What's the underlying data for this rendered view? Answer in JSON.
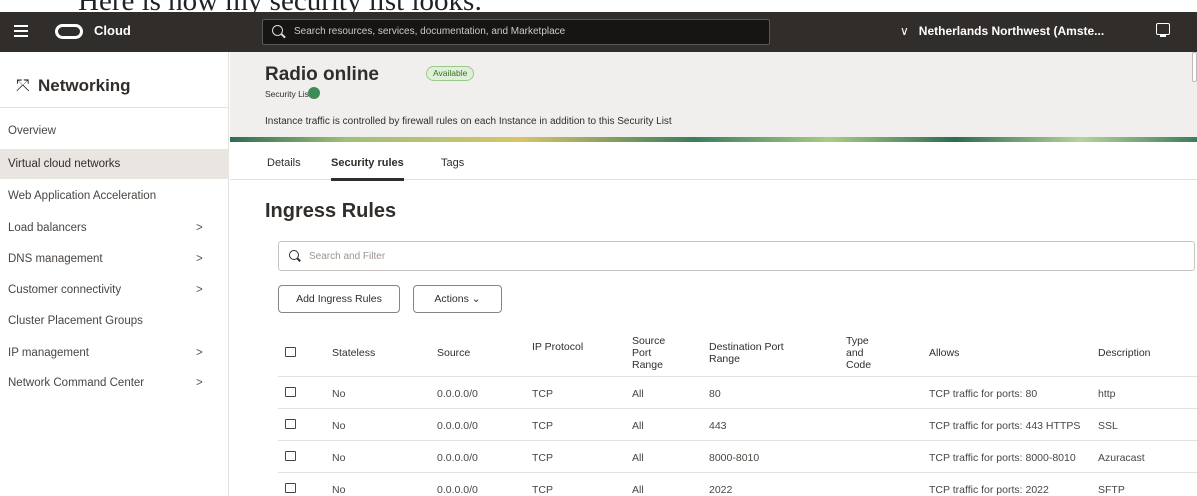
{
  "caption": "Here is how my security list looks:",
  "topbar": {
    "brand": "Cloud",
    "search_placeholder": "Search resources, services, documentation, and Marketplace",
    "region": "Netherlands Northwest (Amste..."
  },
  "sidebar": {
    "title": "Networking",
    "items": [
      {
        "label": "Overview",
        "has_submenu": false
      },
      {
        "label": "Virtual cloud networks",
        "has_submenu": false,
        "active": true
      },
      {
        "label": "Web Application Acceleration",
        "has_submenu": false
      },
      {
        "label": "Load balancers",
        "has_submenu": true
      },
      {
        "label": "DNS management",
        "has_submenu": true
      },
      {
        "label": "Customer connectivity",
        "has_submenu": true
      },
      {
        "label": "Cluster Placement Groups",
        "has_submenu": false
      },
      {
        "label": "IP management",
        "has_submenu": true
      },
      {
        "label": "Network Command Center",
        "has_submenu": true
      }
    ],
    "arrow": ">"
  },
  "header": {
    "resource_name": "Radio online",
    "status_badge": "Available",
    "resource_type": "Security List",
    "info": "Instance traffic is controlled by firewall rules on each Instance in addition to this Security List"
  },
  "tabs": [
    {
      "label": "Details",
      "active": false
    },
    {
      "label": "Security rules",
      "active": true
    },
    {
      "label": "Tags",
      "active": false
    }
  ],
  "ingress": {
    "title": "Ingress Rules",
    "filter_placeholder": "Search and Filter",
    "add_button": "Add Ingress Rules",
    "actions_button": "Actions",
    "columns": [
      "Stateless",
      "Source",
      "IP Protocol",
      "Source Port Range",
      "Destination Port Range",
      "Type and Code",
      "Allows",
      "Description"
    ],
    "rows": [
      {
        "stateless": "No",
        "source": "0.0.0.0/0",
        "protocol": "TCP",
        "src_port": "All",
        "dst_port": "80",
        "type_code": "",
        "allows": "TCP traffic for ports: 80",
        "description": "http"
      },
      {
        "stateless": "No",
        "source": "0.0.0.0/0",
        "protocol": "TCP",
        "src_port": "All",
        "dst_port": "443",
        "type_code": "",
        "allows": "TCP traffic for ports: 443 HTTPS",
        "description": "SSL"
      },
      {
        "stateless": "No",
        "source": "0.0.0.0/0",
        "protocol": "TCP",
        "src_port": "All",
        "dst_port": "8000-8010",
        "type_code": "",
        "allows": "TCP traffic for ports: 8000-8010",
        "description": "Azuracast"
      },
      {
        "stateless": "No",
        "source": "0.0.0.0/0",
        "protocol": "TCP",
        "src_port": "All",
        "dst_port": "2022",
        "type_code": "",
        "allows": "TCP traffic for ports: 2022",
        "description": "SFTP"
      }
    ]
  },
  "colors": {
    "topbar": "#312d2a",
    "accent_green": "#3d8c55",
    "active_bg": "#e9e6e2"
  }
}
